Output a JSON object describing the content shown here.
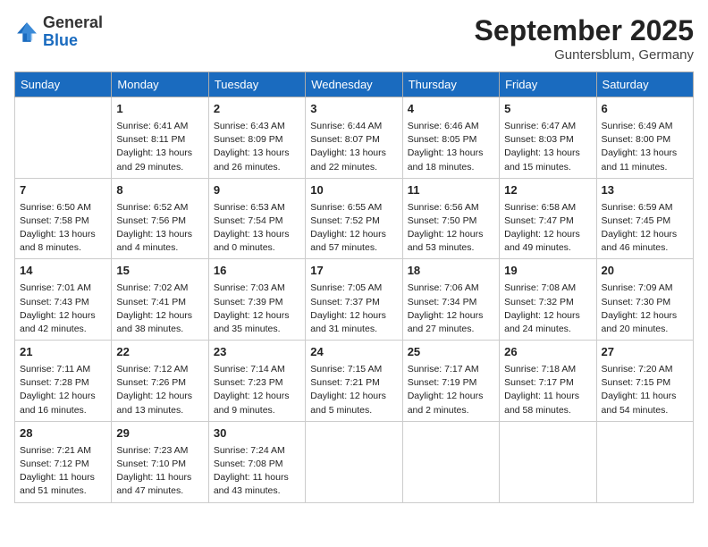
{
  "header": {
    "logo": {
      "general": "General",
      "blue": "Blue"
    },
    "month": "September 2025",
    "location": "Guntersblum, Germany"
  },
  "columns": [
    "Sunday",
    "Monday",
    "Tuesday",
    "Wednesday",
    "Thursday",
    "Friday",
    "Saturday"
  ],
  "weeks": [
    [
      {
        "day": "",
        "sunrise": "",
        "sunset": "",
        "daylight": "",
        "empty": true
      },
      {
        "day": "1",
        "sunrise": "Sunrise: 6:41 AM",
        "sunset": "Sunset: 8:11 PM",
        "daylight": "Daylight: 13 hours and 29 minutes."
      },
      {
        "day": "2",
        "sunrise": "Sunrise: 6:43 AM",
        "sunset": "Sunset: 8:09 PM",
        "daylight": "Daylight: 13 hours and 26 minutes."
      },
      {
        "day": "3",
        "sunrise": "Sunrise: 6:44 AM",
        "sunset": "Sunset: 8:07 PM",
        "daylight": "Daylight: 13 hours and 22 minutes."
      },
      {
        "day": "4",
        "sunrise": "Sunrise: 6:46 AM",
        "sunset": "Sunset: 8:05 PM",
        "daylight": "Daylight: 13 hours and 18 minutes."
      },
      {
        "day": "5",
        "sunrise": "Sunrise: 6:47 AM",
        "sunset": "Sunset: 8:03 PM",
        "daylight": "Daylight: 13 hours and 15 minutes."
      },
      {
        "day": "6",
        "sunrise": "Sunrise: 6:49 AM",
        "sunset": "Sunset: 8:00 PM",
        "daylight": "Daylight: 13 hours and 11 minutes."
      }
    ],
    [
      {
        "day": "7",
        "sunrise": "Sunrise: 6:50 AM",
        "sunset": "Sunset: 7:58 PM",
        "daylight": "Daylight: 13 hours and 8 minutes."
      },
      {
        "day": "8",
        "sunrise": "Sunrise: 6:52 AM",
        "sunset": "Sunset: 7:56 PM",
        "daylight": "Daylight: 13 hours and 4 minutes."
      },
      {
        "day": "9",
        "sunrise": "Sunrise: 6:53 AM",
        "sunset": "Sunset: 7:54 PM",
        "daylight": "Daylight: 13 hours and 0 minutes."
      },
      {
        "day": "10",
        "sunrise": "Sunrise: 6:55 AM",
        "sunset": "Sunset: 7:52 PM",
        "daylight": "Daylight: 12 hours and 57 minutes."
      },
      {
        "day": "11",
        "sunrise": "Sunrise: 6:56 AM",
        "sunset": "Sunset: 7:50 PM",
        "daylight": "Daylight: 12 hours and 53 minutes."
      },
      {
        "day": "12",
        "sunrise": "Sunrise: 6:58 AM",
        "sunset": "Sunset: 7:47 PM",
        "daylight": "Daylight: 12 hours and 49 minutes."
      },
      {
        "day": "13",
        "sunrise": "Sunrise: 6:59 AM",
        "sunset": "Sunset: 7:45 PM",
        "daylight": "Daylight: 12 hours and 46 minutes."
      }
    ],
    [
      {
        "day": "14",
        "sunrise": "Sunrise: 7:01 AM",
        "sunset": "Sunset: 7:43 PM",
        "daylight": "Daylight: 12 hours and 42 minutes."
      },
      {
        "day": "15",
        "sunrise": "Sunrise: 7:02 AM",
        "sunset": "Sunset: 7:41 PM",
        "daylight": "Daylight: 12 hours and 38 minutes."
      },
      {
        "day": "16",
        "sunrise": "Sunrise: 7:03 AM",
        "sunset": "Sunset: 7:39 PM",
        "daylight": "Daylight: 12 hours and 35 minutes."
      },
      {
        "day": "17",
        "sunrise": "Sunrise: 7:05 AM",
        "sunset": "Sunset: 7:37 PM",
        "daylight": "Daylight: 12 hours and 31 minutes."
      },
      {
        "day": "18",
        "sunrise": "Sunrise: 7:06 AM",
        "sunset": "Sunset: 7:34 PM",
        "daylight": "Daylight: 12 hours and 27 minutes."
      },
      {
        "day": "19",
        "sunrise": "Sunrise: 7:08 AM",
        "sunset": "Sunset: 7:32 PM",
        "daylight": "Daylight: 12 hours and 24 minutes."
      },
      {
        "day": "20",
        "sunrise": "Sunrise: 7:09 AM",
        "sunset": "Sunset: 7:30 PM",
        "daylight": "Daylight: 12 hours and 20 minutes."
      }
    ],
    [
      {
        "day": "21",
        "sunrise": "Sunrise: 7:11 AM",
        "sunset": "Sunset: 7:28 PM",
        "daylight": "Daylight: 12 hours and 16 minutes."
      },
      {
        "day": "22",
        "sunrise": "Sunrise: 7:12 AM",
        "sunset": "Sunset: 7:26 PM",
        "daylight": "Daylight: 12 hours and 13 minutes."
      },
      {
        "day": "23",
        "sunrise": "Sunrise: 7:14 AM",
        "sunset": "Sunset: 7:23 PM",
        "daylight": "Daylight: 12 hours and 9 minutes."
      },
      {
        "day": "24",
        "sunrise": "Sunrise: 7:15 AM",
        "sunset": "Sunset: 7:21 PM",
        "daylight": "Daylight: 12 hours and 5 minutes."
      },
      {
        "day": "25",
        "sunrise": "Sunrise: 7:17 AM",
        "sunset": "Sunset: 7:19 PM",
        "daylight": "Daylight: 12 hours and 2 minutes."
      },
      {
        "day": "26",
        "sunrise": "Sunrise: 7:18 AM",
        "sunset": "Sunset: 7:17 PM",
        "daylight": "Daylight: 11 hours and 58 minutes."
      },
      {
        "day": "27",
        "sunrise": "Sunrise: 7:20 AM",
        "sunset": "Sunset: 7:15 PM",
        "daylight": "Daylight: 11 hours and 54 minutes."
      }
    ],
    [
      {
        "day": "28",
        "sunrise": "Sunrise: 7:21 AM",
        "sunset": "Sunset: 7:12 PM",
        "daylight": "Daylight: 11 hours and 51 minutes."
      },
      {
        "day": "29",
        "sunrise": "Sunrise: 7:23 AM",
        "sunset": "Sunset: 7:10 PM",
        "daylight": "Daylight: 11 hours and 47 minutes."
      },
      {
        "day": "30",
        "sunrise": "Sunrise: 7:24 AM",
        "sunset": "Sunset: 7:08 PM",
        "daylight": "Daylight: 11 hours and 43 minutes."
      },
      {
        "day": "",
        "sunrise": "",
        "sunset": "",
        "daylight": "",
        "empty": true
      },
      {
        "day": "",
        "sunrise": "",
        "sunset": "",
        "daylight": "",
        "empty": true
      },
      {
        "day": "",
        "sunrise": "",
        "sunset": "",
        "daylight": "",
        "empty": true
      },
      {
        "day": "",
        "sunrise": "",
        "sunset": "",
        "daylight": "",
        "empty": true
      }
    ]
  ]
}
